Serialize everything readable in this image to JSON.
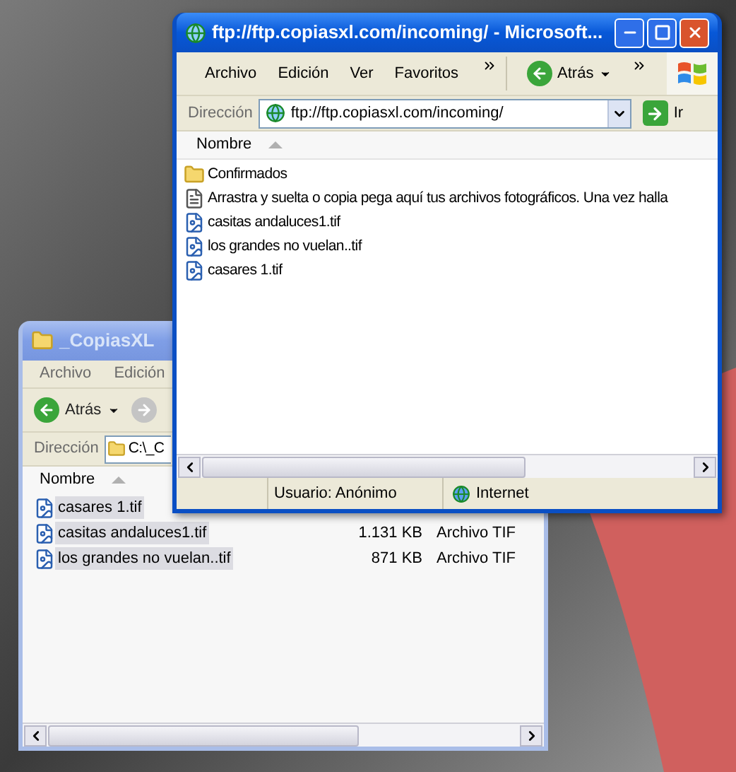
{
  "back_window": {
    "title": "_CopiasXL",
    "active": false,
    "menu": [
      "Archivo",
      "Edición"
    ],
    "toolbar": {
      "back": "Atrás"
    },
    "address": {
      "label": "Dirección",
      "value": "C:\\_C"
    },
    "columns": [
      "Nombre"
    ],
    "files": [
      {
        "kind": "image",
        "name": "casares 1.tif",
        "selected": true
      },
      {
        "kind": "image",
        "name": "casitas andaluces1.tif",
        "size": "1.131 KB",
        "type": "Archivo TIF",
        "selected": true
      },
      {
        "kind": "image",
        "name": "los grandes no vuelan..tif",
        "size": "871 KB",
        "type": "Archivo TIF",
        "selected": true
      }
    ]
  },
  "front_window": {
    "title": "ftp://ftp.copiasxl.com/incoming/ - Microsoft...",
    "active": true,
    "menu": [
      "Archivo",
      "Edición",
      "Ver",
      "Favoritos"
    ],
    "toolbar": {
      "back": "Atrás"
    },
    "address": {
      "label": "Dirección",
      "value": "ftp://ftp.copiasxl.com/incoming/",
      "go": "Ir"
    },
    "columns": [
      "Nombre"
    ],
    "files": [
      {
        "kind": "folder",
        "name": "Confirmados",
        "selected": false
      },
      {
        "kind": "text",
        "name": "Arrastra y suelta o copia pega aquí tus archivos fotográficos. Una vez halla",
        "selected": false
      },
      {
        "kind": "image",
        "name": "casitas andaluces1.tif",
        "selected": false
      },
      {
        "kind": "image",
        "name": "los grandes no vuelan..tif",
        "selected": false
      },
      {
        "kind": "image",
        "name": "casares 1.tif",
        "selected": false
      }
    ],
    "status_bar": [
      "Usuario: Anónimo",
      "Internet"
    ]
  }
}
